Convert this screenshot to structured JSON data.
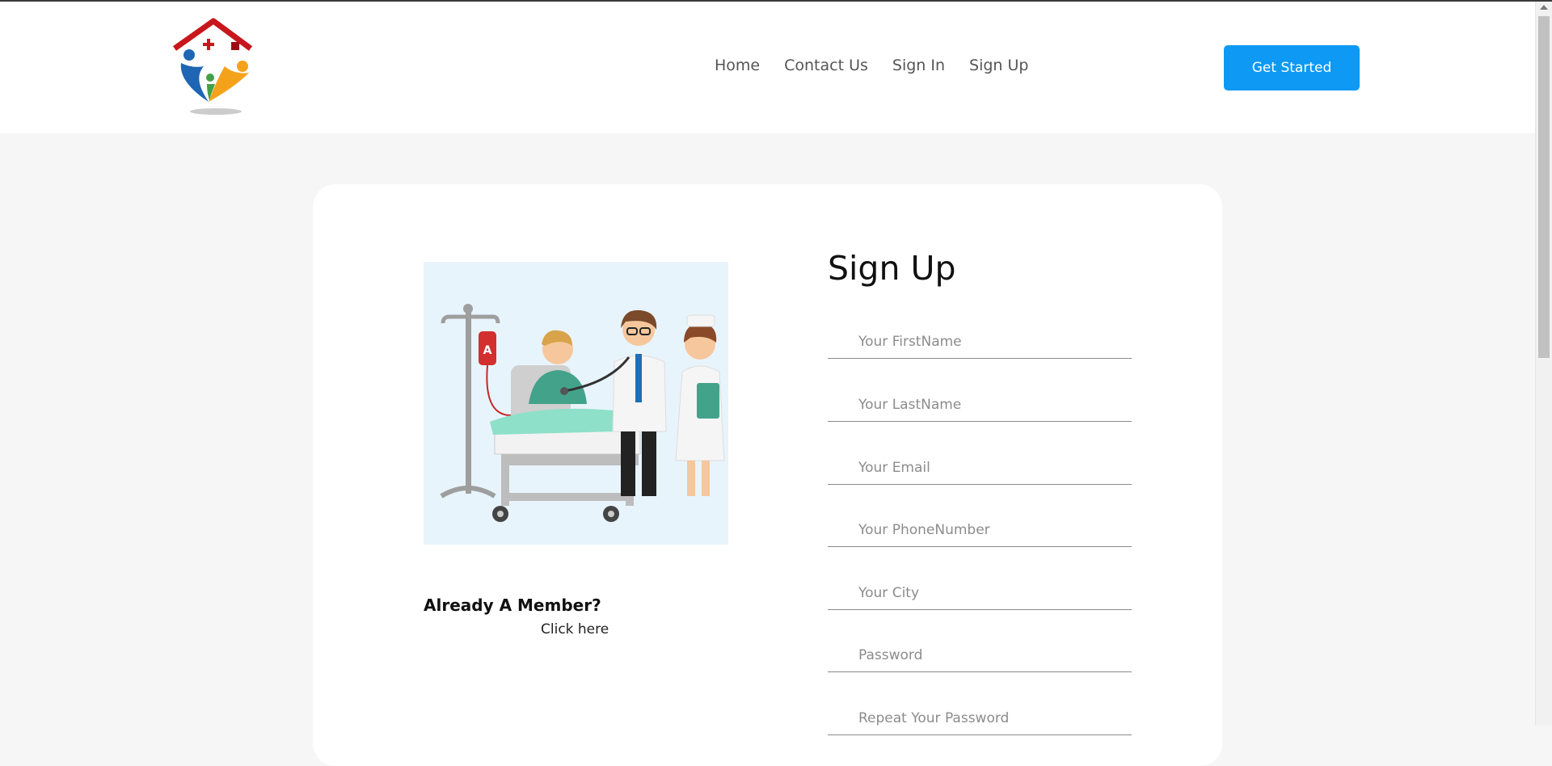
{
  "nav": {
    "items": [
      {
        "label": "Home"
      },
      {
        "label": "Contact Us"
      },
      {
        "label": "Sign In"
      },
      {
        "label": "Sign Up"
      }
    ],
    "cta_label": "Get Started"
  },
  "illustration": {
    "iv_bag_letter": "A"
  },
  "member": {
    "title": "Already A Member?",
    "link_label": "Click here"
  },
  "form": {
    "title": "Sign Up",
    "fields": [
      {
        "placeholder": "Your FirstName",
        "value": ""
      },
      {
        "placeholder": "Your LastName",
        "value": ""
      },
      {
        "placeholder": "Your Email",
        "value": ""
      },
      {
        "placeholder": "Your PhoneNumber",
        "value": ""
      },
      {
        "placeholder": "Your City",
        "value": ""
      },
      {
        "placeholder": "Password",
        "value": ""
      },
      {
        "placeholder": "Repeat Your Password",
        "value": ""
      }
    ]
  },
  "colors": {
    "accent": "#0d99f4",
    "page_bg": "#f6f6f6",
    "card_bg": "#ffffff"
  },
  "icons": [
    "home-heart-logo-icon",
    "scroll-up-arrow-icon"
  ]
}
